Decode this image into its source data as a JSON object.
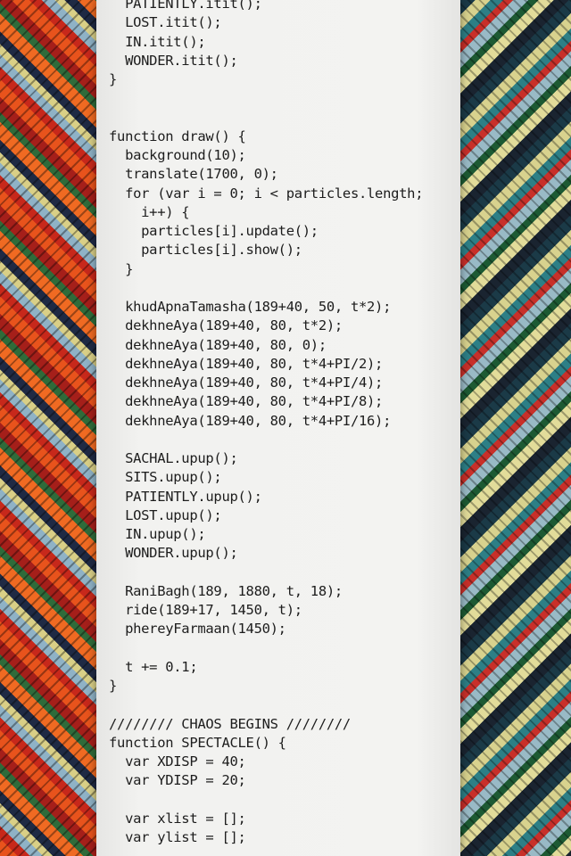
{
  "photo": {
    "subject": "code-printout-on-woven-textile",
    "colors": {
      "paper": "#f2f2f0",
      "ink": "#1d1d1d",
      "textile_orange": "#e8531c",
      "textile_red": "#c7281b",
      "textile_teal": "#2d7f86",
      "textile_yellow": "#d9cf86"
    }
  },
  "code_lines": [
    "  PATIENTLY.itit();",
    "  LOST.itit();",
    "  IN.itit();",
    "  WONDER.itit();",
    "}",
    "",
    "",
    "function draw() {",
    "  background(10);",
    "  translate(1700, 0);",
    "  for (var i = 0; i < particles.length;",
    "    i++) {",
    "    particles[i].update();",
    "    particles[i].show();",
    "  }",
    "",
    "  khudApnaTamasha(189+40, 50, t*2);",
    "  dekhneAya(189+40, 80, t*2);",
    "  dekhneAya(189+40, 80, 0);",
    "  dekhneAya(189+40, 80, t*4+PI/2);",
    "  dekhneAya(189+40, 80, t*4+PI/4);",
    "  dekhneAya(189+40, 80, t*4+PI/8);",
    "  dekhneAya(189+40, 80, t*4+PI/16);",
    "",
    "  SACHAL.upup();",
    "  SITS.upup();",
    "  PATIENTLY.upup();",
    "  LOST.upup();",
    "  IN.upup();",
    "  WONDER.upup();",
    "",
    "  RaniBagh(189, 1880, t, 18);",
    "  ride(189+17, 1450, t);",
    "  phereyFarmaan(1450);",
    "",
    "  t += 0.1;",
    "}",
    "",
    "//////// CHAOS BEGINS ////////",
    "function SPECTACLE() {",
    "  var XDISP = 40;",
    "  var YDISP = 20;",
    "",
    "  var xlist = [];",
    "  var ylist = [];"
  ]
}
